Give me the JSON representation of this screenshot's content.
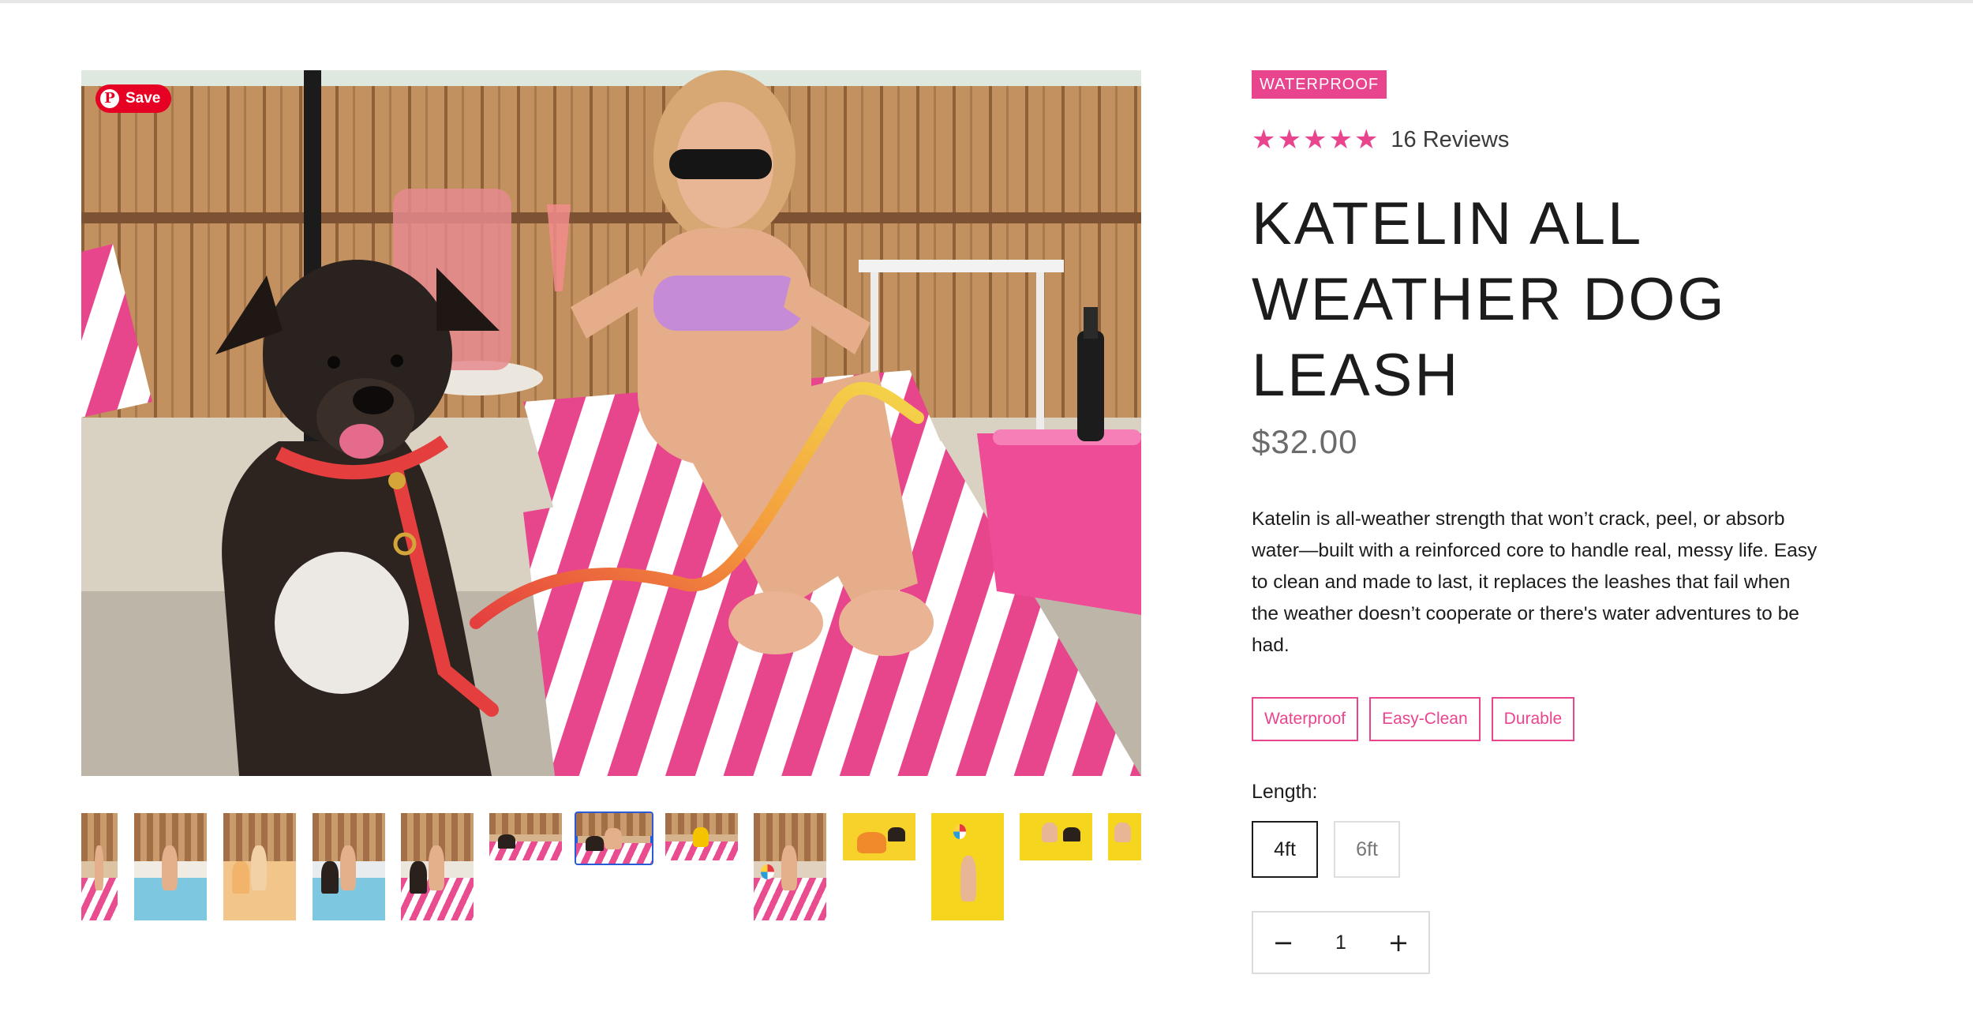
{
  "gallery": {
    "pin_save_label": "Save",
    "pin_logo": "P",
    "main_image_alt": "Dog on leash beside woman on striped lounge chair",
    "active_thumbnail_index": 6,
    "thumbnail_count": 13
  },
  "product": {
    "badge": "WATERPROOF",
    "rating": 5,
    "stars": [
      "★",
      "★",
      "★",
      "★",
      "★"
    ],
    "reviews": "16 Reviews",
    "title": "KATELIN ALL WEATHER DOG LEASH",
    "price": "$32.00",
    "description": "Katelin is all-weather strength that won’t crack, peel, or absorb water—built with a reinforced core to handle real, messy life. Easy to clean and made to last, it replaces the leashes that fail when the weather doesn’t cooperate or there's water adventures to be had.",
    "tags": [
      "Waterproof",
      "Easy-Clean",
      "Durable"
    ],
    "length_label": "Length:",
    "length_options": [
      "4ft",
      "6ft"
    ],
    "selected_length": "4ft",
    "quantity": "1",
    "qty_minus": "−",
    "qty_plus": "+"
  },
  "colors": {
    "accent_pink": "#e9448e",
    "pinterest_red": "#e60023",
    "active_thumb_border": "#2a5bd7"
  }
}
